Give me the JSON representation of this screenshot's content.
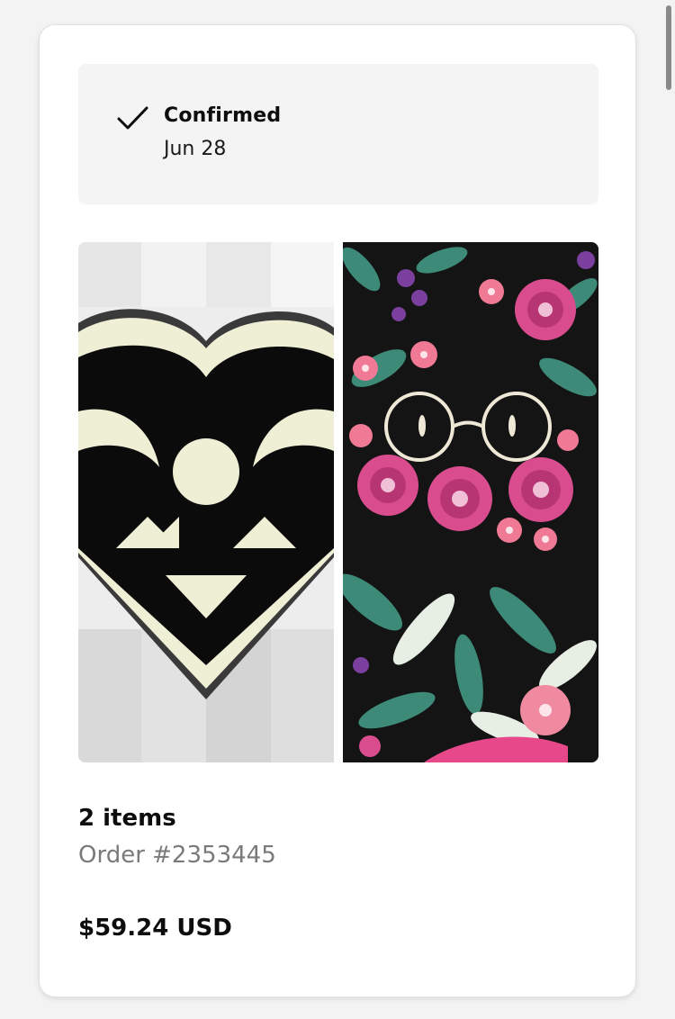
{
  "status": {
    "icon": "checkmark-icon",
    "label": "Confirmed",
    "date": "Jun 28"
  },
  "products": [
    {
      "image": "heart-enamel-pin-image"
    },
    {
      "image": "floral-glasses-pattern-image"
    }
  ],
  "summary": {
    "items_count": "2 items",
    "order_number": "Order #2353445",
    "total": "$59.24 USD"
  },
  "colors": {
    "card_background": "#ffffff",
    "page_background": "#f3f3f3",
    "status_panel": "#f4f4f4",
    "muted_text": "#7a7a7a",
    "primary_text": "#0d0d0d"
  }
}
